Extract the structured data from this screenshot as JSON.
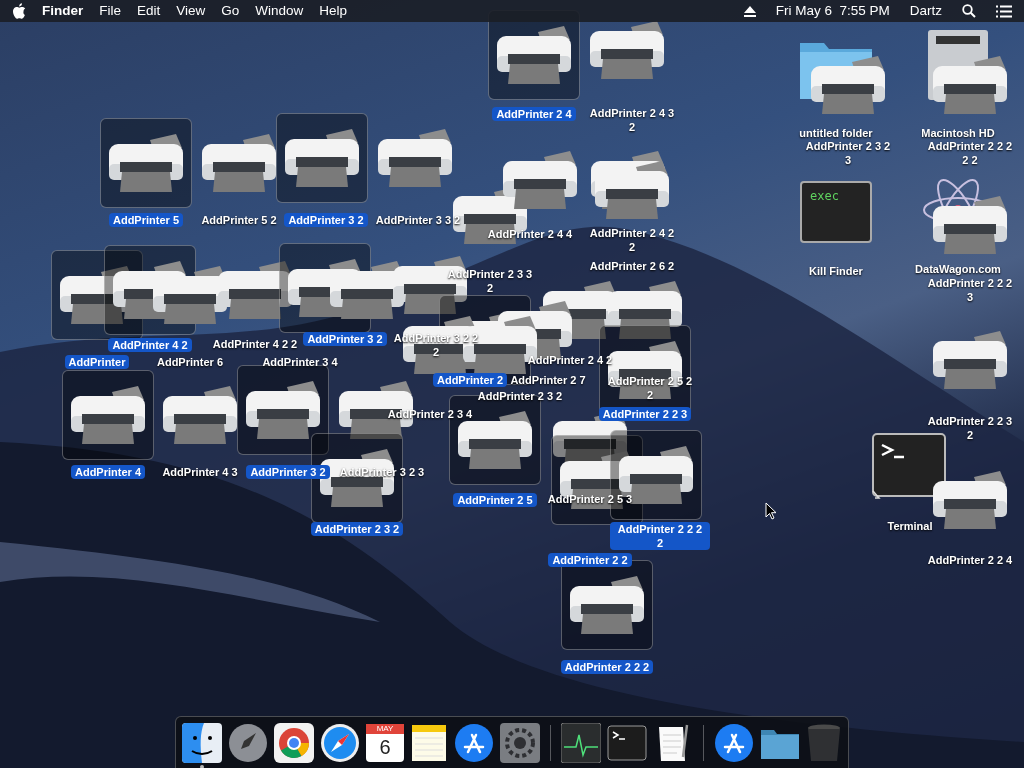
{
  "menu_bar": {
    "app": "Finder",
    "menus": [
      "File",
      "Edit",
      "View",
      "Go",
      "Window",
      "Help"
    ],
    "clock": "Fri May 6  7:55 PM",
    "user": "Dartz"
  },
  "desktop_items": [
    {
      "kind": "printer",
      "label": "AddPrinter 2 4",
      "selected": true
    },
    {
      "kind": "printer",
      "label": "AddPrinter 2 4 3 2",
      "selected": false
    },
    {
      "kind": "printer",
      "label": "AddPrinter 5",
      "selected": true
    },
    {
      "kind": "printer",
      "label": "AddPrinter 5 2",
      "selected": false
    },
    {
      "kind": "printer",
      "label": "AddPrinter 3 2",
      "selected": true
    },
    {
      "kind": "printer",
      "label": "AddPrinter 3 3 2",
      "selected": false
    },
    {
      "kind": "printer",
      "label": "AddPrinter 2 3 3 2",
      "selected": false
    },
    {
      "kind": "printer",
      "label": "AddPrinter 2 4 4",
      "selected": false
    },
    {
      "kind": "printer",
      "label": "AddPrinter 2 4 2 2",
      "selected": false
    },
    {
      "kind": "printer",
      "label": "AddPrinter 2 6 2",
      "selected": false
    },
    {
      "kind": "printer",
      "label": "AddPrinter",
      "selected": true
    },
    {
      "kind": "printer",
      "label": "AddPrinter 4 2",
      "selected": true
    },
    {
      "kind": "printer",
      "label": "AddPrinter 6",
      "selected": false
    },
    {
      "kind": "printer",
      "label": "AddPrinter 4 2 2",
      "selected": false
    },
    {
      "kind": "printer",
      "label": "AddPrinter 3 2",
      "selected": true
    },
    {
      "kind": "printer",
      "label": "AddPrinter 3 4",
      "selected": false
    },
    {
      "kind": "printer",
      "label": "AddPrinter 3 2 2 2",
      "selected": false
    },
    {
      "kind": "printer",
      "label": "AddPrinter 2 4 2",
      "selected": false
    },
    {
      "kind": "printer",
      "label": "AddPrinter 2",
      "selected": true
    },
    {
      "kind": "printer",
      "label": "AddPrinter 2 7",
      "selected": false
    },
    {
      "kind": "printer",
      "label": "AddPrinter 2 5 2 2",
      "selected": false
    },
    {
      "kind": "printer",
      "label": "AddPrinter 2 3 4",
      "selected": false
    },
    {
      "kind": "printer",
      "label": "AddPrinter 2 3 2",
      "selected": false
    },
    {
      "kind": "printer",
      "label": "AddPrinter 2 2 3",
      "selected": true
    },
    {
      "kind": "printer",
      "label": "AddPrinter 4",
      "selected": true
    },
    {
      "kind": "printer",
      "label": "AddPrinter 4 3",
      "selected": false
    },
    {
      "kind": "printer",
      "label": "AddPrinter 3 2",
      "selected": true
    },
    {
      "kind": "printer",
      "label": "AddPrinter 3 2 3",
      "selected": false
    },
    {
      "kind": "printer",
      "label": "AddPrinter 2 3 2",
      "selected": true
    },
    {
      "kind": "printer",
      "label": "AddPrinter 2 5",
      "selected": true
    },
    {
      "kind": "printer",
      "label": "AddPrinter 2 5 3",
      "selected": false
    },
    {
      "kind": "printer",
      "label": "AddPrinter 2 2",
      "selected": true
    },
    {
      "kind": "printer",
      "label": "AddPrinter 2 2 2 2",
      "selected": true
    },
    {
      "kind": "printer",
      "label": "AddPrinter 2 2 2",
      "selected": true
    },
    {
      "kind": "folder",
      "label": "untitled folder",
      "selected": false
    },
    {
      "kind": "printer",
      "label": "AddPrinter 2 3 2 3",
      "selected": false
    },
    {
      "kind": "drive",
      "label": "Macintosh HD",
      "selected": false
    },
    {
      "kind": "printer",
      "label": "AddPrinter 2 2 2 2 2",
      "selected": false
    },
    {
      "kind": "exec",
      "label": "Kill Finder",
      "icon_text": "exec",
      "selected": false
    },
    {
      "kind": "atom",
      "label": "DataWagon.com",
      "selected": false
    },
    {
      "kind": "printer",
      "label": "AddPrinter 2 2 2 3",
      "selected": false
    },
    {
      "kind": "printer",
      "label": "AddPrinter 2 2 3 2",
      "selected": false
    },
    {
      "kind": "terminal",
      "label": "Terminal",
      "selected": false
    },
    {
      "kind": "printer",
      "label": "AddPrinter 2 2 4",
      "selected": false
    }
  ],
  "dock": [
    {
      "kind": "finder",
      "running": true
    },
    {
      "kind": "launchpad",
      "running": false
    },
    {
      "kind": "chrome",
      "running": false
    },
    {
      "kind": "safari",
      "running": false
    },
    {
      "kind": "calendar",
      "month": "MAY",
      "day": "6",
      "running": false
    },
    {
      "kind": "notes",
      "running": false
    },
    {
      "kind": "appstore",
      "running": false
    },
    {
      "kind": "settings",
      "running": false
    },
    {
      "kind": "separator"
    },
    {
      "kind": "activity",
      "running": false
    },
    {
      "kind": "terminal",
      "running": false
    },
    {
      "kind": "textedit",
      "running": false
    },
    {
      "kind": "separator"
    },
    {
      "kind": "appstore",
      "running": false
    },
    {
      "kind": "folder",
      "running": false
    },
    {
      "kind": "trash",
      "running": false
    }
  ]
}
